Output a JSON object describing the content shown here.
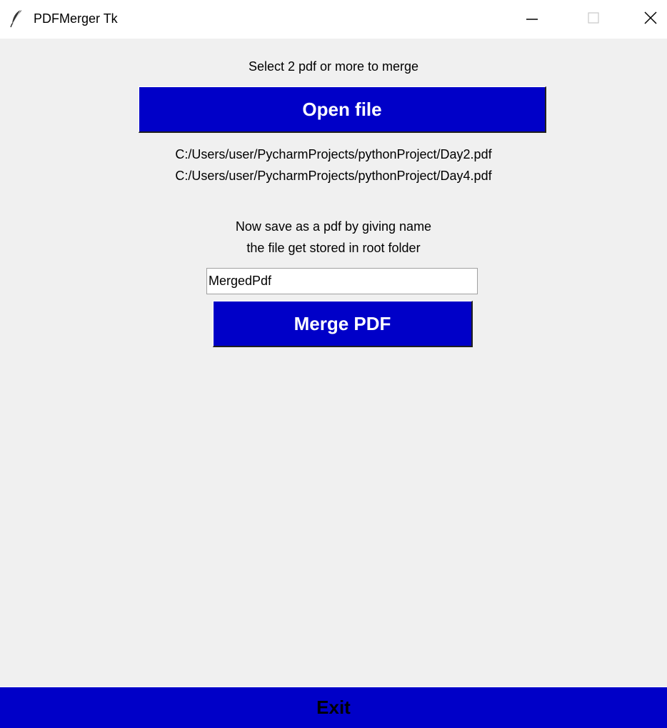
{
  "window": {
    "title": "PDFMerger Tk",
    "app_icon": "feather-icon",
    "controls": {
      "minimize_icon": "minimize-icon",
      "maximize_icon": "maximize-icon",
      "close_icon": "close-icon"
    }
  },
  "main": {
    "instruction": "Select 2 pdf or more to merge",
    "open_button_label": "Open file",
    "selected_files": [
      "C:/Users/user/PycharmProjects/pythonProject/Day2.pdf",
      "C:/Users/user/PycharmProjects/pythonProject/Day4.pdf"
    ],
    "save_instruction_lines": [
      "Now save as a pdf by giving name",
      "the file get stored in root folder"
    ],
    "filename_input_value": "MergedPdf",
    "merge_button_label": "Merge PDF"
  },
  "footer": {
    "exit_label": "Exit"
  },
  "colors": {
    "button_background": "#0000c8",
    "window_background": "#f0f0f0",
    "titlebar_background": "#ffffff"
  }
}
